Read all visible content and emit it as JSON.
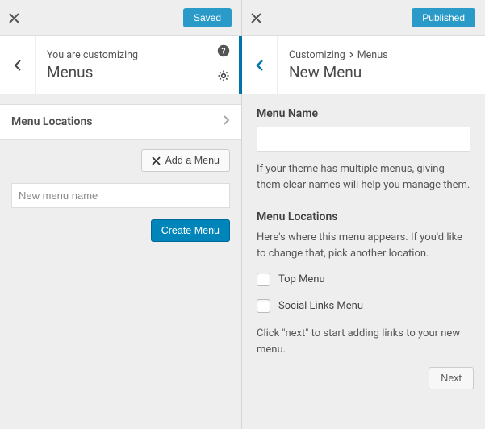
{
  "left": {
    "saved_label": "Saved",
    "customizing_label": "You are customizing",
    "title": "Menus",
    "menu_locations_label": "Menu Locations",
    "add_menu_label": "Add a Menu",
    "new_menu_placeholder": "New menu name",
    "create_menu_label": "Create Menu"
  },
  "right": {
    "published_label": "Published",
    "breadcrumb_root": "Customizing",
    "breadcrumb_parent": "Menus",
    "title": "New Menu",
    "menu_name_label": "Menu Name",
    "menu_name_help": "If your theme has multiple menus, giving them clear names will help you manage them.",
    "menu_locations_label": "Menu Locations",
    "menu_locations_help": "Here's where this menu appears. If you'd like to change that, pick another location.",
    "checkboxes": [
      {
        "label": "Top Menu"
      },
      {
        "label": "Social Links Menu"
      }
    ],
    "next_help": "Click \"next\" to start adding links to your new menu.",
    "next_label": "Next"
  }
}
